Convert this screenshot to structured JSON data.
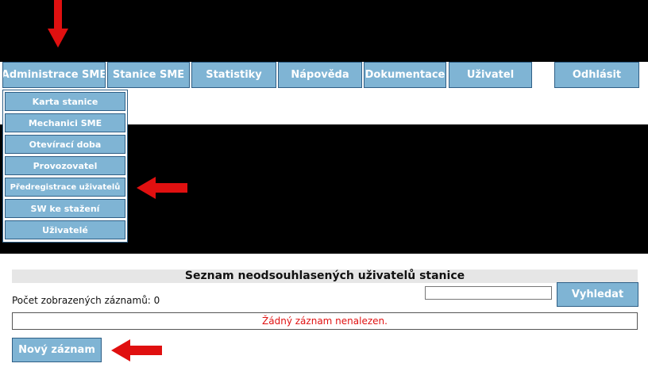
{
  "nav": {
    "items": [
      {
        "label": "Administrace SME"
      },
      {
        "label": "Stanice SME"
      },
      {
        "label": "Statistiky"
      },
      {
        "label": "Nápověda"
      },
      {
        "label": "Dokumentace"
      },
      {
        "label": "Uživatel"
      }
    ],
    "logout_label": "Odhlásit"
  },
  "submenu": {
    "items": [
      {
        "label": "Karta stanice"
      },
      {
        "label": "Mechanici SME"
      },
      {
        "label": "Otevírací doba"
      },
      {
        "label": "Provozovatel"
      },
      {
        "label": "Předregistrace uživatelů"
      },
      {
        "label": "SW ke stažení"
      },
      {
        "label": "Uživatelé"
      }
    ]
  },
  "list": {
    "title": "Seznam neodsouhlasených uživatelů stanice",
    "count_label": "Počet zobrazených záznamů: 0",
    "search_value": "",
    "search_button": "Vyhledat",
    "empty_message": "Žádný záznam nenalezen.",
    "new_button": "Nový záznam"
  },
  "colors": {
    "button_bg": "#7fb4d4",
    "button_border": "#2f5f86",
    "arrow": "#e01010",
    "empty_text": "#e01010"
  },
  "annotations": {
    "arrow_icon": "red-arrow"
  }
}
